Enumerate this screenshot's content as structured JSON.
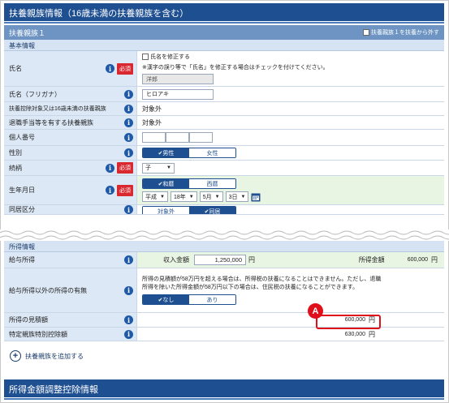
{
  "header": {
    "title": "扶養親族情報（16歳未満の扶養親族を含む）"
  },
  "dependent": {
    "section_title": "扶養親族１",
    "remove_label": "扶養親族１を扶養から外す",
    "subhead": "基本情報",
    "name": {
      "label": "氏名",
      "required": "必須",
      "fix_checkbox_label": "氏名を修正する",
      "note": "※漢字の誤り等で「氏名」を修正する場合はチェックを付けてください。",
      "value": "洋郎"
    },
    "kana": {
      "label": "氏名（フリガナ）",
      "value": "ヒロアキ"
    },
    "deduction_target": {
      "label": "扶養控除対象又は16歳未満の扶養親族",
      "value": "対象外"
    },
    "retirement_allowance": {
      "label": "退職手当等を有する扶養親族",
      "value": "対象外"
    },
    "my_number": {
      "label": "個人番号"
    },
    "gender": {
      "label": "性別",
      "options": [
        "✔男性",
        "女性"
      ]
    },
    "relation": {
      "label": "続柄",
      "required": "必須",
      "value": "子"
    },
    "birthdate": {
      "label": "生年月日",
      "required": "必須",
      "era_options": [
        "✔和暦",
        "西暦"
      ],
      "era": "平成",
      "year": "18年",
      "month": "5月",
      "day": "3日"
    },
    "cohabit": {
      "label": "同居区分",
      "options": [
        "対象外",
        "✔同居"
      ]
    }
  },
  "income": {
    "subhead": "所得情報",
    "salary": {
      "label": "給与所得",
      "income_label": "収入金額",
      "income_value": "1,250,000",
      "unit": "円",
      "amount_label": "所得金額",
      "amount_value": "600,000"
    },
    "other_income": {
      "label": "給与所得以外の所得の有無",
      "note": "所得の見積額が58万円を超える場合は、所得税の扶養になることはできません。ただし、退職所得を除いた所得金額が58万円以下の場合は、住民税の扶養になることができます。",
      "options": [
        "✔なし",
        "あり"
      ]
    },
    "estimate": {
      "label": "所得の見積額",
      "value": "600,000",
      "unit": "円"
    },
    "special": {
      "label": "特定親族特別控除額",
      "value": "630,000",
      "unit": "円"
    }
  },
  "add_label": "扶養親族を追加する",
  "bottom": {
    "title": "所得金額調整控除情報"
  },
  "annotation": {
    "badge": "A"
  }
}
